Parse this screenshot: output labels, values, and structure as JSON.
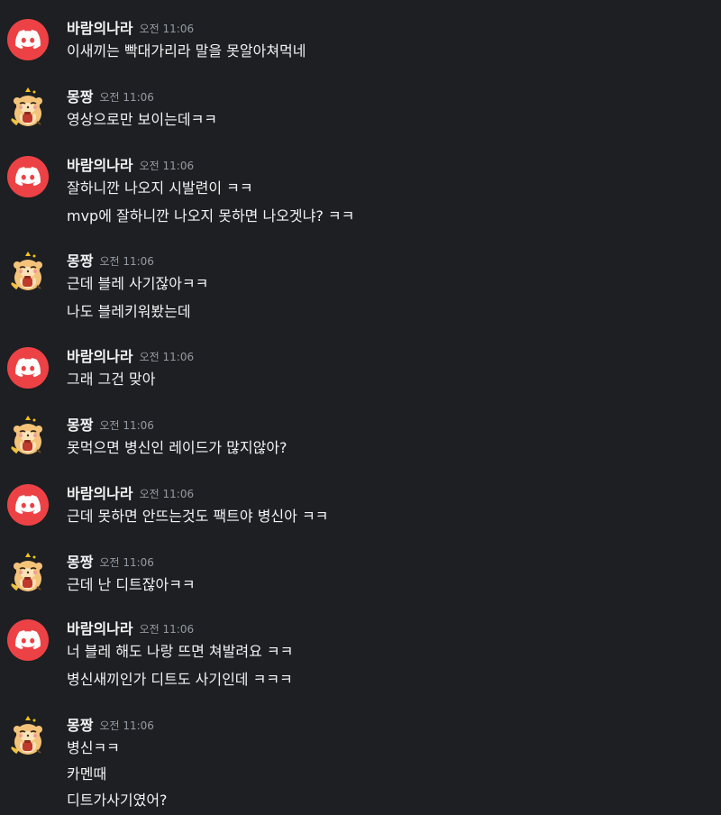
{
  "groups": [
    {
      "author": "바람의나라",
      "avatar": "discord-logo-avatar",
      "time": "오전 11:06",
      "messages": [
        "이새끼는 빡대가리라 말을 못알아쳐먹네"
      ]
    },
    {
      "author": "몽짱",
      "avatar": "hamster-avatar",
      "time": "오전 11:06",
      "messages": [
        "영상으로만 보이는데ㅋㅋ"
      ]
    },
    {
      "author": "바람의나라",
      "avatar": "discord-logo-avatar",
      "time": "오전 11:06",
      "messages": [
        "잘하니깐 나오지 시발련이 ㅋㅋ",
        "mvp에 잘하니깐 나오지 못하면 나오겟냐? ㅋㅋ"
      ]
    },
    {
      "author": "몽짱",
      "avatar": "hamster-avatar",
      "time": "오전 11:06",
      "messages": [
        "근데 블레 사기잖아ㅋㅋ",
        "나도 블레키워봤는데"
      ]
    },
    {
      "author": "바람의나라",
      "avatar": "discord-logo-avatar",
      "time": "오전 11:06",
      "messages": [
        "그래 그건 맞아"
      ]
    },
    {
      "author": "몽짱",
      "avatar": "hamster-avatar",
      "time": "오전 11:06",
      "messages": [
        "못먹으면 병신인 레이드가 많지않아?"
      ]
    },
    {
      "author": "바람의나라",
      "avatar": "discord-logo-avatar",
      "time": "오전 11:06",
      "messages": [
        "근데 못하면 안뜨는것도 팩트야 병신아 ㅋㅋ"
      ]
    },
    {
      "author": "몽짱",
      "avatar": "hamster-avatar",
      "time": "오전 11:06",
      "messages": [
        "근데 난 디트잖아ㅋㅋ"
      ]
    },
    {
      "author": "바람의나라",
      "avatar": "discord-logo-avatar",
      "time": "오전 11:06",
      "messages": [
        "너 블레 해도 나랑 뜨면 쳐발려요 ㅋㅋ",
        "병신새끼인가 디트도 사기인데 ㅋㅋㅋ"
      ]
    },
    {
      "author": "몽짱",
      "avatar": "hamster-avatar",
      "time": "오전 11:06",
      "messages": [
        "병신ㅋㅋ",
        "카멘때",
        "디트가사기였어?"
      ]
    }
  ],
  "colors": {
    "background": "#1e1f22",
    "username": "#f2f3f5",
    "timestamp": "#949ba4",
    "message": "#f2f3f5",
    "discord_avatar": "#ed4245"
  }
}
